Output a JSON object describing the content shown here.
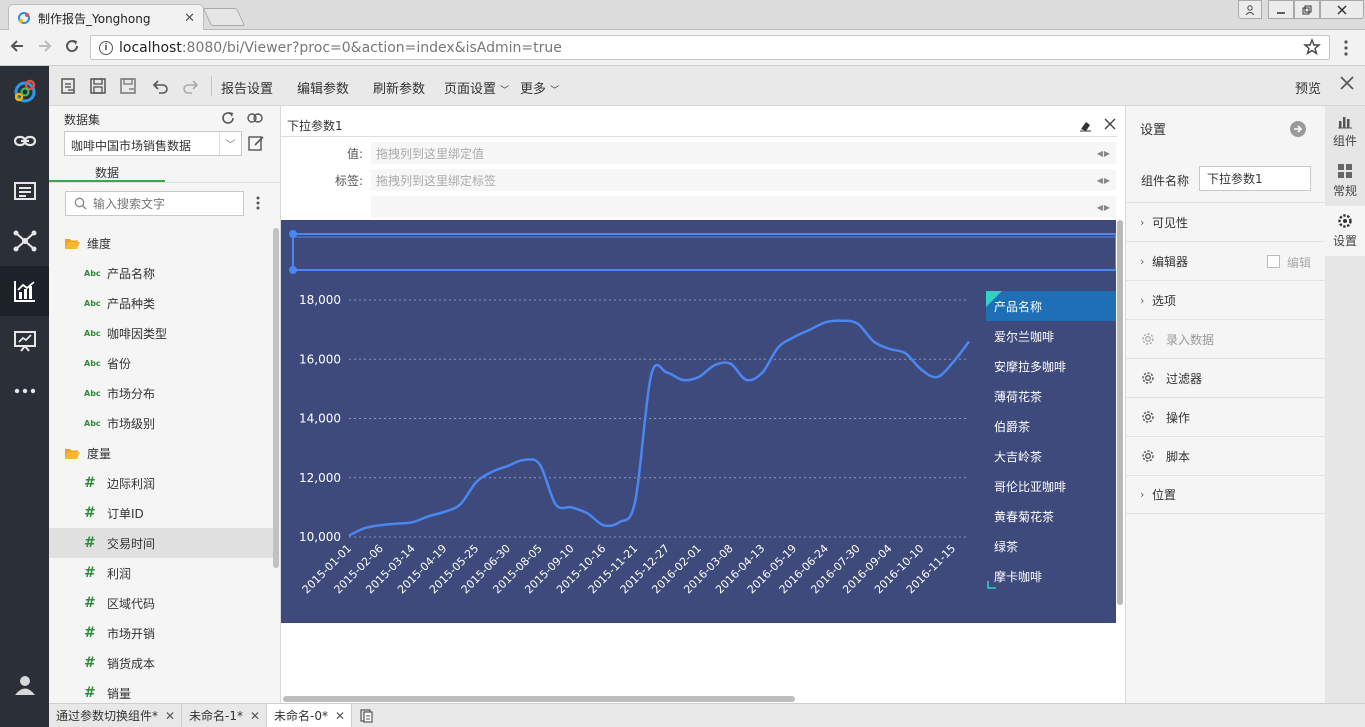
{
  "browser": {
    "tab_title": "制作报告_Yonghong",
    "tab_close": "✕",
    "url_host": "localhost",
    "url_path": ":8080/bi/Viewer?proc=0&action=index&isAdmin=true"
  },
  "toolbar": {
    "report_settings": "报告设置",
    "edit_params": "编辑参数",
    "refresh_params": "刷新参数",
    "page_settings": "页面设置",
    "more": "更多",
    "preview": "预览"
  },
  "data_panel": {
    "dataset_label": "数据集",
    "dataset_selected": "咖啡中国市场销售数据",
    "data_tab": "数据",
    "search_placeholder": "输入搜索文字",
    "dimension_folder": "维度",
    "dimensions": [
      "产品名称",
      "产品种类",
      "咖啡因类型",
      "省份",
      "市场分布",
      "市场级别"
    ],
    "measure_folder": "度量",
    "measures": [
      "边际利润",
      "订单ID",
      "交易时间",
      "利润",
      "区域代码",
      "市场开销",
      "销货成本",
      "销量"
    ],
    "selected_measure": "交易时间",
    "abc_badge": "Abc",
    "hash_badge": "#"
  },
  "param": {
    "title": "下拉参数1",
    "value_label": "值:",
    "value_placeholder": "拖拽列到这里绑定值",
    "tag_label": "标签:",
    "tag_placeholder": "拖拽列到这里绑定标签"
  },
  "chart_data": {
    "type": "line",
    "x": [
      "2015-01-01",
      "2015-01-19",
      "2015-02-06",
      "2015-02-24",
      "2015-03-14",
      "2015-04-01",
      "2015-04-19",
      "2015-05-07",
      "2015-05-25",
      "2015-06-12",
      "2015-06-30",
      "2015-07-18",
      "2015-08-05",
      "2015-08-23",
      "2015-09-10",
      "2015-09-28",
      "2015-10-16",
      "2015-11-03",
      "2015-11-21",
      "2015-12-09",
      "2015-12-27",
      "2016-01-14",
      "2016-02-01",
      "2016-02-19",
      "2016-03-08",
      "2016-03-26",
      "2016-04-13",
      "2016-05-01",
      "2016-05-19",
      "2016-06-06",
      "2016-06-24",
      "2016-07-12",
      "2016-07-30",
      "2016-08-17",
      "2016-09-04",
      "2016-09-22",
      "2016-10-10",
      "2016-10-28",
      "2016-11-15",
      "2016-12-03"
    ],
    "y": [
      10050,
      10300,
      10400,
      10450,
      10500,
      10700,
      10850,
      11100,
      11850,
      12200,
      12400,
      12600,
      12450,
      11100,
      11000,
      10800,
      10400,
      10500,
      11200,
      15450,
      15550,
      15300,
      15400,
      15800,
      15850,
      15300,
      15550,
      16400,
      16750,
      17000,
      17250,
      17300,
      17200,
      16600,
      16350,
      16200,
      15650,
      15400,
      15900,
      16600
    ],
    "ytick_labels": [
      "10,000",
      "12,000",
      "14,000",
      "16,000",
      "18,000"
    ],
    "xtick_labels": [
      "2015-01-01",
      "2015-02-06",
      "2015-03-14",
      "2015-04-19",
      "2015-05-25",
      "2015-06-30",
      "2015-08-05",
      "2015-09-10",
      "2015-10-16",
      "2015-11-21",
      "2015-12-27",
      "2016-02-01",
      "2016-03-08",
      "2016-04-13",
      "2016-05-19",
      "2016-06-24",
      "2016-07-30",
      "2016-09-04",
      "2016-10-10",
      "2016-11-15"
    ],
    "ylim": [
      10000,
      18000
    ],
    "grid": "horizontal dotted",
    "line_color": "#4a87f2",
    "background": "#3e4a7c"
  },
  "legend": {
    "title": "产品名称",
    "items": [
      "爱尔兰咖啡",
      "安摩拉多咖啡",
      "薄荷花茶",
      "伯爵茶",
      "大吉岭茶",
      "哥伦比亚咖啡",
      "黄春菊花茶",
      "绿茶",
      "摩卡咖啡"
    ]
  },
  "settings": {
    "title": "设置",
    "component_name_label": "组件名称",
    "component_name_value": "下拉参数1",
    "visibility": "可见性",
    "editor": "编辑器",
    "editor_check_label": "编辑",
    "options": "选项",
    "input_data": "录入数据",
    "filter": "过滤器",
    "operation": "操作",
    "script": "脚本",
    "position": "位置"
  },
  "right_tabs": {
    "component": "组件",
    "general": "常规",
    "settings": "设置"
  },
  "doc_tabs": [
    {
      "label": "通过参数切换组件*"
    },
    {
      "label": "未命名-1*"
    },
    {
      "label": "未命名-0*"
    }
  ],
  "colors": {
    "accent_green": "#2eae4e",
    "chart_bg": "#3e4a7c",
    "legend_header": "#1e6fb5",
    "rail_bg": "#2b3038"
  }
}
